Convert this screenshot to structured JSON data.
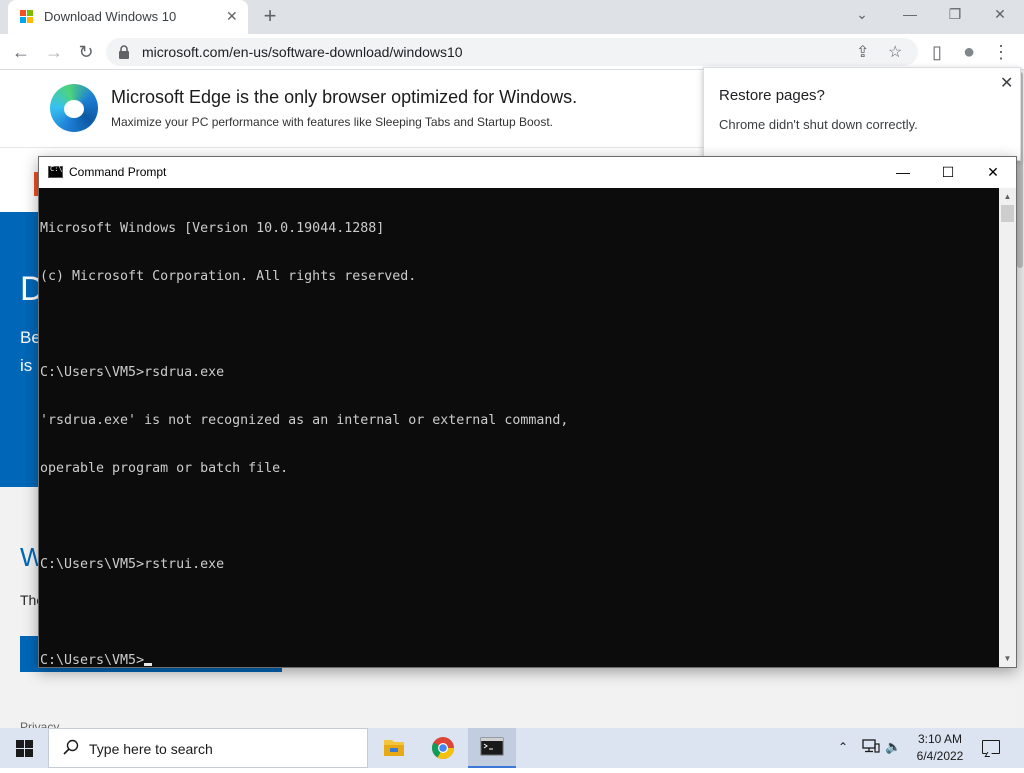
{
  "browser": {
    "tab": {
      "title": "Download Windows 10",
      "close_glyph": "✕"
    },
    "new_tab_glyph": "+",
    "window_controls": {
      "dropdown": "⌄",
      "minimize": "—",
      "restore": "❐",
      "close": "✕"
    },
    "toolbar": {
      "back": "←",
      "forward": "→",
      "reload": "↻",
      "url": "microsoft.com/en-us/software-download/windows10",
      "share": "⇪",
      "bookmark": "☆",
      "sidepanel": "▯",
      "profile": "●",
      "menu": "⋮"
    }
  },
  "page": {
    "edge_banner": {
      "title": "Microsoft Edge is the only browser optimized for Windows.",
      "subtitle": "Maximize your PC performance with features like Sleeping Tabs and Startup Boost."
    },
    "hero": {
      "heading_fragment": "D",
      "line1_fragment": "Be",
      "line2_fragment": "is"
    },
    "section": {
      "heading_fragment": "W",
      "text_fragment": "The"
    },
    "footer_link": "Privacy"
  },
  "restore_popup": {
    "title": "Restore pages?",
    "message": "Chrome didn't shut down correctly.",
    "close_glyph": "✕"
  },
  "cmd": {
    "window_title": "Command Prompt",
    "icon_text": "C:\\_",
    "controls": {
      "minimize": "—",
      "maximize": "☐",
      "close": "✕"
    },
    "lines": [
      "Microsoft Windows [Version 10.0.19044.1288]",
      "(c) Microsoft Corporation. All rights reserved.",
      "",
      "C:\\Users\\VM5>rsdrua.exe",
      "'rsdrua.exe' is not recognized as an internal or external command,",
      "operable program or batch file.",
      "",
      "C:\\Users\\VM5>rstrui.exe",
      ""
    ],
    "prompt": "C:\\Users\\VM5>",
    "scroll_up": "▲",
    "scroll_down": "▼"
  },
  "taskbar": {
    "search_placeholder": "Type here to search",
    "apps": [
      "file-explorer",
      "google-chrome",
      "command-prompt"
    ],
    "tray_up": "⌃",
    "volume": "🔈",
    "time": "3:10 AM",
    "date": "6/4/2022"
  },
  "colors": {
    "ms_blue": "#0067b8",
    "console_bg": "#0c0c0c",
    "console_fg": "#cccccc",
    "taskbar": "#dbe4f0"
  }
}
